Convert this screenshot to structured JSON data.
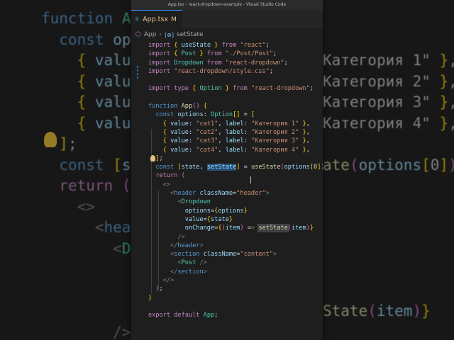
{
  "window": {
    "title": "App.tsx - react-dropdown-example - Visual Studio Code"
  },
  "tab": {
    "name": "App.tsx",
    "modified": "M"
  },
  "breadcrumb": {
    "file": "App",
    "symbol": "setState"
  },
  "code_lines": [
    "import { useState } from \"react\";",
    "import { Post } from \"./Post/Post\";",
    "import Dropdown from \"react-dropdown\";",
    "import \"react-dropdown/style.css\";",
    "",
    "import type { Option } from \"react-dropdown\";",
    "",
    "function App() {",
    "  const options: Option[] = [",
    "    { value: \"cat1\", label: \"Категория 1\" },",
    "    { value: \"cat2\", label: \"Категория 2\" },",
    "    { value: \"cat3\", label: \"Категория 3\" },",
    "    { value: \"cat4\", label: \"Категория 4\" },",
    "  ];",
    "  const [state, setState] = useState(options[0]);",
    "  return (",
    "    <>",
    "      <header className=\"header\">",
    "        <Dropdown",
    "          options={options}",
    "          value={state}",
    "          onChange={(item) => setState(item)}",
    "        />",
    "      </header>",
    "      <section className=\"content\">",
    "        <Post />",
    "      </section>",
    "    </>",
    "  );",
    "}",
    "",
    "export default App;"
  ],
  "background_code": [
    "function App",
    "  const opt",
    "    { value",
    "    { value",
    "    { value",
    "    { value",
    "  ];",
    "  const [sta",
    "  return (",
    "    <>",
    "      <head",
    "        <Dr",
    "          o",
    "          v",
    "          o",
    "        />"
  ],
  "background_code_right": [
    "",
    "",
    "Категория 1\" },",
    "Категория 2\" },",
    "Категория 3\" },",
    "Категория 4\" },",
    "",
    "ate(options[0]);",
    "",
    "",
    "",
    "",
    "",
    "",
    "State(item)}",
    ""
  ],
  "colors": {
    "keyword": "#c586c0",
    "keyword_blue": "#569cd6",
    "string": "#ce9178",
    "variable": "#9cdcfe",
    "function": "#dcdcaa",
    "type": "#4ec9b0",
    "editor_bg": "#1e1e1e"
  }
}
